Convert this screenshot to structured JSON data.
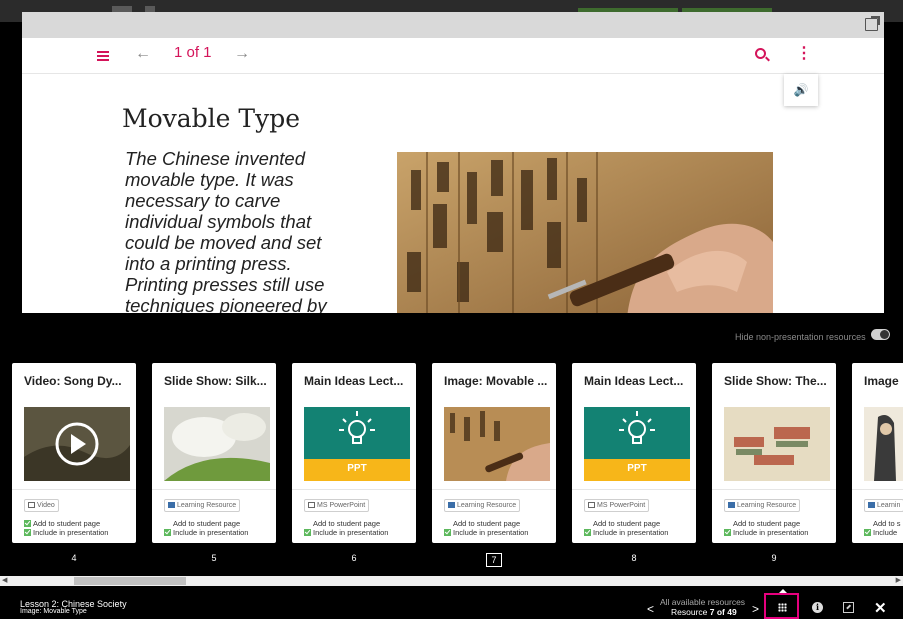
{
  "viewer": {
    "page_indicator": "1 of 1",
    "prev_arrow": "←",
    "next_arrow": "→",
    "more": "⋮",
    "audio": "🔊"
  },
  "slide": {
    "title": "Movable Type",
    "body": "The Chinese invented movable type. It was necessary to carve individual symbols that could be moved and set into a printing press. Printing presses still use techniques pioneered by the Chinese."
  },
  "panel": {
    "hide_label": "Hide non-presentation resources"
  },
  "cards": [
    {
      "title": "Video: Song Dy...",
      "type": "Video",
      "check1": "Add to student page",
      "check2": "Include in presentation",
      "number": "4"
    },
    {
      "title": "Slide Show: Silk...",
      "type": "Learning Resource",
      "check1": "Add to student page",
      "check2": "Include in presentation",
      "number": "5"
    },
    {
      "title": "Main Ideas Lect...",
      "type": "MS PowerPoint",
      "check1": "Add to student page",
      "check2": "Include in presentation",
      "number": "6",
      "ppt": "PPT"
    },
    {
      "title": "Image: Movable ...",
      "type": "Learning Resource",
      "check1": "Add to student page",
      "check2": "Include in presentation",
      "number": "7"
    },
    {
      "title": "Main Ideas Lect...",
      "type": "MS PowerPoint",
      "check1": "Add to student page",
      "check2": "Include in presentation",
      "number": "8",
      "ppt": "PPT"
    },
    {
      "title": "Slide Show: The...",
      "type": "Learning Resource",
      "check1": "Add to student page",
      "check2": "Include in presentation",
      "number": "9"
    },
    {
      "title": "Image",
      "type": "Learnin",
      "check1": "Add to s",
      "check2": "Include",
      "number": ""
    }
  ],
  "footer": {
    "lesson": "Lesson 2: Chinese Society",
    "resource_name": "Image: Movable Type",
    "all_label": "All available resources",
    "resource_prefix": "Resource",
    "resource_pos": "7 of 49",
    "prev": "<",
    "next": ">",
    "close": "✕"
  },
  "colors": {
    "accent": "#d4145a",
    "highlight": "#e6007e",
    "ppt_teal": "#138273",
    "ppt_yellow": "#f7b619"
  }
}
